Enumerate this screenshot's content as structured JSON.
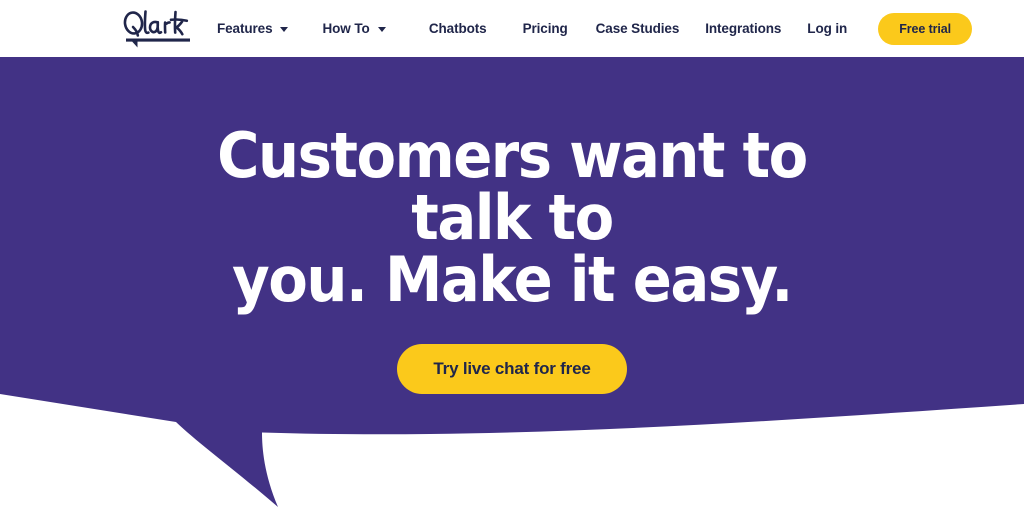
{
  "brand": {
    "logo_text": "Olark",
    "logo_icon": "olark-script-wordmark-with-speech-bubble-underline",
    "purple": "#423285",
    "yellow": "#fbc91b",
    "navy": "#20264a"
  },
  "header": {
    "nav_left": [
      {
        "label": "Features",
        "has_dropdown": true
      },
      {
        "label": "How To",
        "has_dropdown": true
      }
    ],
    "nav_right": [
      {
        "label": "Chatbots"
      },
      {
        "label": "Pricing"
      },
      {
        "label": "Case Studies"
      },
      {
        "label": "Integrations"
      },
      {
        "label": "Log in"
      }
    ],
    "free_trial_label": "Free trial"
  },
  "hero": {
    "headline_line_1": "Customers want to talk to",
    "headline_line_2": "you. Make it easy.",
    "cta_label": "Try live chat for free"
  }
}
